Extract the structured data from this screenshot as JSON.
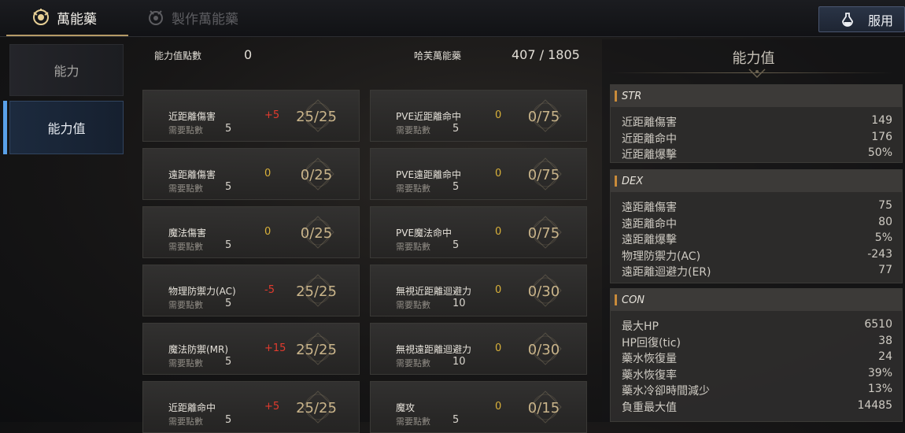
{
  "tabs": {
    "active": "萬能藥",
    "inactive": "製作萬能藥"
  },
  "use_button": "服用",
  "sidebar": {
    "items": [
      {
        "label": "能力"
      },
      {
        "label": "能力值"
      }
    ]
  },
  "header": {
    "points_label": "能力值點數",
    "points_value": "0",
    "elixir_label": "哈芙萬能藥",
    "elixir_value": "407 / 1805"
  },
  "cards_left": [
    {
      "name": "近距離傷害",
      "req_label": "需要點數",
      "req": "5",
      "bonus": "+5",
      "ratio": "25/25"
    },
    {
      "name": "遠距離傷害",
      "req_label": "需要點數",
      "req": "5",
      "bonus": "0",
      "ratio": "0/25"
    },
    {
      "name": "魔法傷害",
      "req_label": "需要點數",
      "req": "5",
      "bonus": "0",
      "ratio": "0/25"
    },
    {
      "name": "物理防禦力(AC)",
      "req_label": "需要點數",
      "req": "5",
      "bonus": "-5",
      "ratio": "25/25"
    },
    {
      "name": "魔法防禦(MR)",
      "req_label": "需要點數",
      "req": "5",
      "bonus": "+15",
      "ratio": "25/25"
    },
    {
      "name": "近距離命中",
      "req_label": "需要點數",
      "req": "5",
      "bonus": "+5",
      "ratio": "25/25"
    }
  ],
  "cards_right": [
    {
      "name": "PVE近距離命中",
      "req_label": "需要點數",
      "req": "5",
      "bonus": "0",
      "ratio": "0/75"
    },
    {
      "name": "PVE遠距離命中",
      "req_label": "需要點數",
      "req": "5",
      "bonus": "0",
      "ratio": "0/75"
    },
    {
      "name": "PVE魔法命中",
      "req_label": "需要點數",
      "req": "5",
      "bonus": "0",
      "ratio": "0/75"
    },
    {
      "name": "無視近距離迴避力",
      "req_label": "需要點數",
      "req": "10",
      "bonus": "0",
      "ratio": "0/30"
    },
    {
      "name": "無視遠距離迴避力",
      "req_label": "需要點數",
      "req": "10",
      "bonus": "0",
      "ratio": "0/30"
    },
    {
      "name": "魔攻",
      "req_label": "需要點數",
      "req": "5",
      "bonus": "0",
      "ratio": "0/15"
    }
  ],
  "stats_panel": {
    "title": "能力值",
    "groups": [
      {
        "label": "STR",
        "rows": [
          {
            "k": "近距離傷害",
            "v": "149"
          },
          {
            "k": "近距離命中",
            "v": "176"
          },
          {
            "k": "近距離爆擊",
            "v": "50%"
          }
        ]
      },
      {
        "label": "DEX",
        "rows": [
          {
            "k": "遠距離傷害",
            "v": "75"
          },
          {
            "k": "遠距離命中",
            "v": "80"
          },
          {
            "k": "遠距離爆擊",
            "v": "5%"
          },
          {
            "k": "物理防禦力(AC)",
            "v": "-243"
          },
          {
            "k": "遠距離迴避力(ER)",
            "v": "77"
          }
        ]
      },
      {
        "label": "CON",
        "rows": [
          {
            "k": "最大HP",
            "v": "6510"
          },
          {
            "k": "HP回復(tic)",
            "v": "38"
          },
          {
            "k": "藥水恢復量",
            "v": "24"
          },
          {
            "k": "藥水恢復率",
            "v": "39%"
          },
          {
            "k": "藥水冷卻時間減少",
            "v": "13%"
          },
          {
            "k": "負重最大值",
            "v": "14485"
          }
        ]
      }
    ]
  },
  "colors": {
    "positive": "#e23b2e",
    "negative": "#e23b2e",
    "neutral": "#d9b13a",
    "accent_blue": "#5aa0e8",
    "gold": "#c9b48a"
  }
}
